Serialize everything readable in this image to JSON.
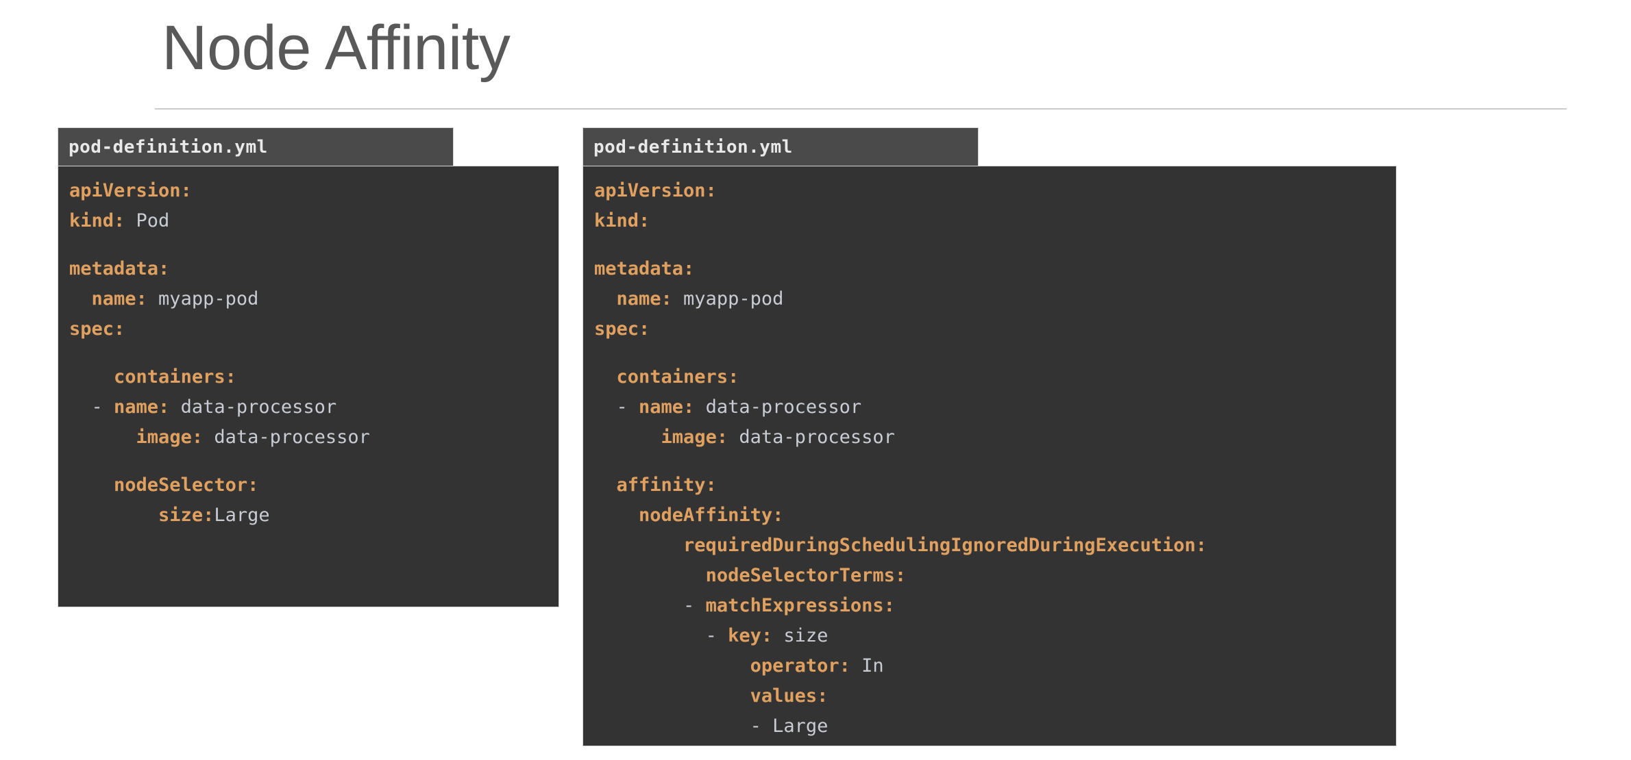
{
  "slide": {
    "title": "Node Affinity"
  },
  "blocks": [
    {
      "id": "pod-definition-nodeselector",
      "filename": "pod-definition.yml",
      "lines": [
        {
          "type": "kv",
          "indent": 0,
          "key": "apiVersion:",
          "value": ""
        },
        {
          "type": "kv",
          "indent": 0,
          "key": "kind:",
          "value": "Pod"
        },
        {
          "type": "blank"
        },
        {
          "type": "kv",
          "indent": 0,
          "key": "metadata:",
          "value": ""
        },
        {
          "type": "kv",
          "indent": 1,
          "key": "name:",
          "value": "myapp-pod"
        },
        {
          "type": "kv",
          "indent": 0,
          "key": "spec:",
          "value": ""
        },
        {
          "type": "blank"
        },
        {
          "type": "kv",
          "indent": 2,
          "key": "containers:",
          "value": ""
        },
        {
          "type": "item",
          "indent": 1,
          "key": "name:",
          "value": "data-processor"
        },
        {
          "type": "kv",
          "indent": 3,
          "key": "image:",
          "value": "data-processor"
        },
        {
          "type": "blank"
        },
        {
          "type": "kv",
          "indent": 2,
          "key": "nodeSelector:",
          "value": ""
        },
        {
          "type": "kvtight",
          "indent": 4,
          "key": "size:",
          "value": "Large"
        }
      ]
    },
    {
      "id": "pod-definition-nodeaffinity",
      "filename": "pod-definition.yml",
      "lines": [
        {
          "type": "kv",
          "indent": 0,
          "key": "apiVersion:",
          "value": ""
        },
        {
          "type": "kv",
          "indent": 0,
          "key": "kind:",
          "value": ""
        },
        {
          "type": "blank"
        },
        {
          "type": "kv",
          "indent": 0,
          "key": "metadata:",
          "value": ""
        },
        {
          "type": "kv",
          "indent": 1,
          "key": "name:",
          "value": "myapp-pod"
        },
        {
          "type": "kv",
          "indent": 0,
          "key": "spec:",
          "value": ""
        },
        {
          "type": "blank"
        },
        {
          "type": "kv",
          "indent": 1,
          "key": "containers:",
          "value": ""
        },
        {
          "type": "item",
          "indent": 1,
          "key": "name:",
          "value": "data-processor"
        },
        {
          "type": "kv",
          "indent": 3,
          "key": "image:",
          "value": "data-processor"
        },
        {
          "type": "blank"
        },
        {
          "type": "kv",
          "indent": 1,
          "key": "affinity:",
          "value": ""
        },
        {
          "type": "kv",
          "indent": 2,
          "key": "nodeAffinity:",
          "value": ""
        },
        {
          "type": "kv",
          "indent": 4,
          "key": "requiredDuringSchedulingIgnoredDuringExecution:",
          "value": ""
        },
        {
          "type": "kv",
          "indent": 5,
          "key": "nodeSelectorTerms:",
          "value": ""
        },
        {
          "type": "item",
          "indent": 4,
          "key": "matchExpressions:",
          "value": ""
        },
        {
          "type": "item",
          "indent": 5,
          "key": "key:",
          "value": "size"
        },
        {
          "type": "kv",
          "indent": 7,
          "key": "operator:",
          "value": "In"
        },
        {
          "type": "kv",
          "indent": 7,
          "key": "values:",
          "value": ""
        },
        {
          "type": "dash",
          "indent": 7,
          "key": "",
          "value": "Large"
        }
      ]
    }
  ],
  "colors": {
    "background": "#ffffff",
    "title_text": "#595959",
    "rule": "#c9c9c9",
    "code_header_bg": "#4a4a4a",
    "code_body_bg": "#333333",
    "code_key": "#e0a060",
    "code_value": "#c8ccd4",
    "code_header_text": "#e9e9e9"
  }
}
